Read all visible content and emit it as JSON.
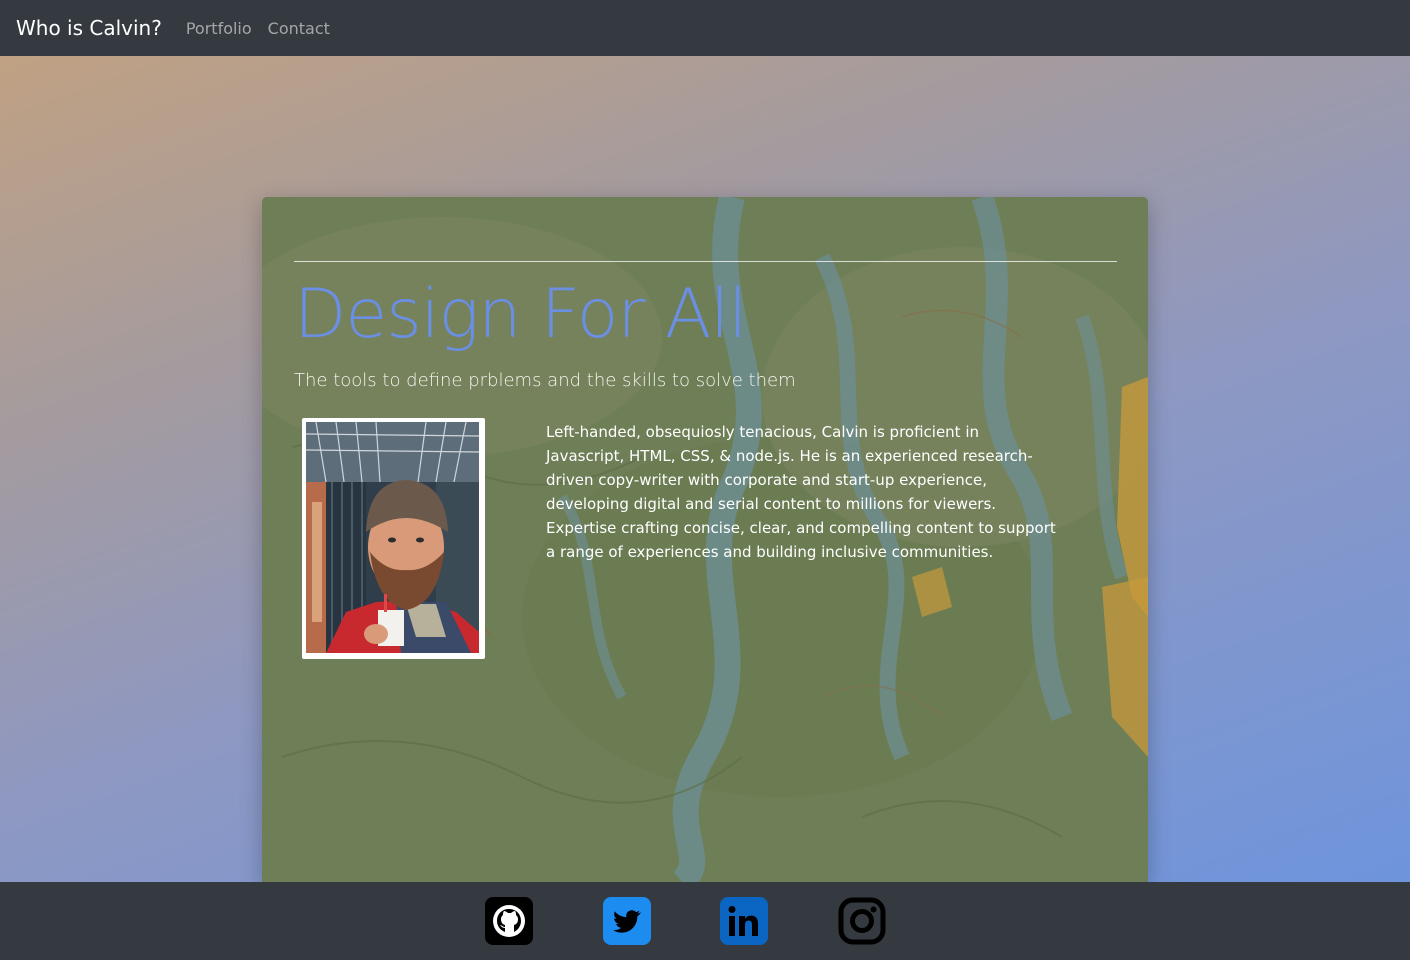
{
  "navbar": {
    "brand": "Who is Calvin?",
    "links": [
      "Portfolio",
      "Contact"
    ]
  },
  "hero": {
    "headline": "Design For All",
    "tagline": "The tools to define prblems and the skills to solve them",
    "bio": "Left-handed, obsequiosly tenacious, Calvin is proficient in Javascript, HTML, CSS, & node.js. He is an experienced research-driven copy-writer with corporate and start-up experience, developing digital and serial content to millions for viewers. Expertise crafting concise, clear, and compelling content to support a range of experiences and building inclusive communities."
  },
  "footer": {
    "social": [
      {
        "name": "github",
        "icon": "github-icon"
      },
      {
        "name": "twitter",
        "icon": "twitter-icon"
      },
      {
        "name": "linkedin",
        "icon": "linkedin-icon"
      },
      {
        "name": "instagram",
        "icon": "instagram-icon"
      }
    ]
  },
  "colors": {
    "navbar": "#343a40",
    "headline": "#6a8fe3",
    "twitter": "#1d8cf0",
    "linkedin": "#0a66c2"
  }
}
